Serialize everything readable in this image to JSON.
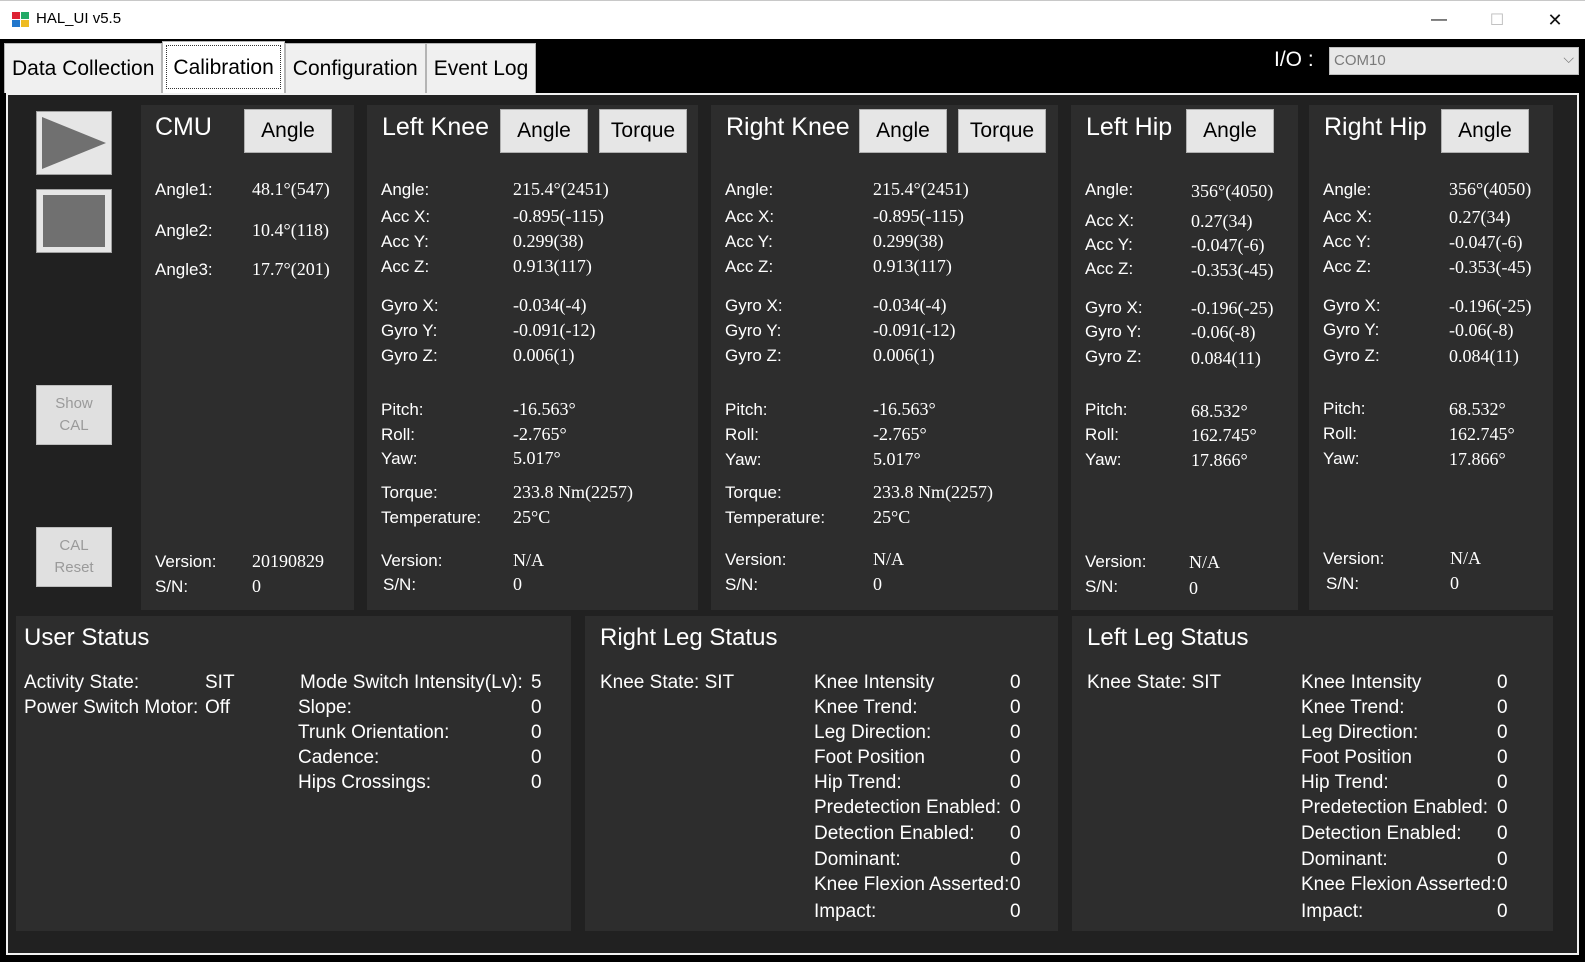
{
  "window": {
    "title": "HAL_UI v5.5",
    "min": "—",
    "max": "☐",
    "close": "✕"
  },
  "tabs": [
    "Data Collection",
    "Calibration",
    "Configuration",
    "Event Log"
  ],
  "io": {
    "label": "I/O :",
    "value": "COM10",
    "arrow": "⌵"
  },
  "side": {
    "show_cal": "Show CAL",
    "cal_reset": "CAL Reset"
  },
  "cmu": {
    "title": "CMU",
    "angle_btn": "Angle",
    "angle1_label": "Angle1:",
    "angle1": "48.1°(547)",
    "angle2_label": "Angle2:",
    "angle2": "10.4°(118)",
    "angle3_label": "Angle3:",
    "angle3": "17.7°(201)",
    "version_label": "Version:",
    "version": "20190829",
    "sn_label": "S/N:",
    "sn": "0"
  },
  "left_knee": {
    "title": "Left Knee",
    "angle_btn": "Angle",
    "torque_btn": "Torque",
    "labels": {
      "angle": "Angle:",
      "accx": "Acc X:",
      "accy": "Acc Y:",
      "accz": "Acc Z:",
      "gyrox": "Gyro X:",
      "gyroy": "Gyro Y:",
      "gyroz": "Gyro Z:",
      "pitch": "Pitch:",
      "roll": "Roll:",
      "yaw": "Yaw:",
      "torque": "Torque:",
      "temp": "Temperature:",
      "version": "Version:",
      "sn": "S/N:"
    },
    "angle": "215.4°(2451)",
    "accx": "-0.895(-115)",
    "accy": "0.299(38)",
    "accz": "0.913(117)",
    "gyrox": "-0.034(-4)",
    "gyroy": "-0.091(-12)",
    "gyroz": "0.006(1)",
    "pitch": "-16.563°",
    "roll": "-2.765°",
    "yaw": "5.017°",
    "torque": "233.8 Nm(2257)",
    "temp": "25°C",
    "version": "N/A",
    "sn": "0"
  },
  "right_knee": {
    "title": "Right Knee",
    "angle_btn": "Angle",
    "torque_btn": "Torque",
    "labels": {
      "angle": "Angle:",
      "accx": "Acc X:",
      "accy": "Acc Y:",
      "accz": "Acc Z:",
      "gyrox": "Gyro X:",
      "gyroy": "Gyro Y:",
      "gyroz": "Gyro Z:",
      "pitch": "Pitch:",
      "roll": "Roll:",
      "yaw": "Yaw:",
      "torque": "Torque:",
      "temp": "Temperature:",
      "version": "Version:",
      "sn": "S/N:"
    },
    "angle": "215.4°(2451)",
    "accx": "-0.895(-115)",
    "accy": "0.299(38)",
    "accz": "0.913(117)",
    "gyrox": "-0.034(-4)",
    "gyroy": "-0.091(-12)",
    "gyroz": "0.006(1)",
    "pitch": "-16.563°",
    "roll": "-2.765°",
    "yaw": "5.017°",
    "torque": "233.8 Nm(2257)",
    "temp": "25°C",
    "version": "N/A",
    "sn": "0"
  },
  "left_hip": {
    "title": "Left Hip",
    "angle_btn": "Angle",
    "labels": {
      "angle": "Angle:",
      "accx": "Acc X:",
      "accy": "Acc Y:",
      "accz": "Acc Z:",
      "gyrox": "Gyro X:",
      "gyroy": "Gyro Y:",
      "gyroz": "Gyro Z:",
      "pitch": "Pitch:",
      "roll": "Roll:",
      "yaw": "Yaw:",
      "version": "Version:",
      "sn": "S/N:"
    },
    "angle": "356°(4050)",
    "accx": "0.27(34)",
    "accy": "-0.047(-6)",
    "accz": "-0.353(-45)",
    "gyrox": "-0.196(-25)",
    "gyroy": "-0.06(-8)",
    "gyroz": "0.084(11)",
    "pitch": "68.532°",
    "roll": "162.745°",
    "yaw": "17.866°",
    "version": "N/A",
    "sn": "0"
  },
  "right_hip": {
    "title": "Right Hip",
    "angle_btn": "Angle",
    "labels": {
      "angle": "Angle:",
      "accx": "Acc X:",
      "accy": "Acc Y:",
      "accz": "Acc Z:",
      "gyrox": "Gyro X:",
      "gyroy": "Gyro Y:",
      "gyroz": "Gyro Z:",
      "pitch": "Pitch:",
      "roll": "Roll:",
      "yaw": "Yaw:",
      "version": "Version:",
      "sn": "S/N:"
    },
    "angle": "356°(4050)",
    "accx": "0.27(34)",
    "accy": "-0.047(-6)",
    "accz": "-0.353(-45)",
    "gyrox": "-0.196(-25)",
    "gyroy": "-0.06(-8)",
    "gyroz": "0.084(11)",
    "pitch": "68.532°",
    "roll": "162.745°",
    "yaw": "17.866°",
    "version": "N/A",
    "sn": "0"
  },
  "user_status": {
    "title": "User Status",
    "activity_label": "Activity State:",
    "activity": "SIT",
    "psm_label": "Power Switch Motor:",
    "psm": "Off",
    "msi_label": "Mode Switch Intensity(Lv):",
    "msi": "5",
    "slope_label": "Slope:",
    "slope": "0",
    "trunk_label": "Trunk Orientation:",
    "trunk": "0",
    "cadence_label": "Cadence:",
    "cadence": "0",
    "hips_label": "Hips Crossings:",
    "hips": "0"
  },
  "right_leg": {
    "title": "Right Leg Status",
    "knee_state": "Knee State:  SIT",
    "items": [
      {
        "label": "Knee Intensity",
        "value": "0"
      },
      {
        "label": "Knee Trend:",
        "value": "0"
      },
      {
        "label": "Leg Direction:",
        "value": "0"
      },
      {
        "label": "Foot Position",
        "value": "0"
      },
      {
        "label": "Hip Trend:",
        "value": "0"
      },
      {
        "label": "Predetection Enabled:",
        "value": "0"
      },
      {
        "label": "Detection Enabled:",
        "value": "0"
      },
      {
        "label": "Dominant:",
        "value": "0"
      },
      {
        "label": "Knee Flexion Asserted:",
        "value": "0"
      },
      {
        "label": "Impact:",
        "value": "0"
      }
    ]
  },
  "left_leg": {
    "title": "Left Leg Status",
    "knee_state": "Knee State:  SIT",
    "items": [
      {
        "label": "Knee Intensity",
        "value": "0"
      },
      {
        "label": "Knee Trend:",
        "value": "0"
      },
      {
        "label": "Leg Direction:",
        "value": "0"
      },
      {
        "label": "Foot Position",
        "value": "0"
      },
      {
        "label": "Hip Trend:",
        "value": "0"
      },
      {
        "label": "Predetection Enabled:",
        "value": "0"
      },
      {
        "label": "Detection Enabled:",
        "value": "0"
      },
      {
        "label": "Dominant:",
        "value": "0"
      },
      {
        "label": "Knee Flexion Asserted:",
        "value": "0"
      },
      {
        "label": "Impact:",
        "value": "0"
      }
    ]
  }
}
